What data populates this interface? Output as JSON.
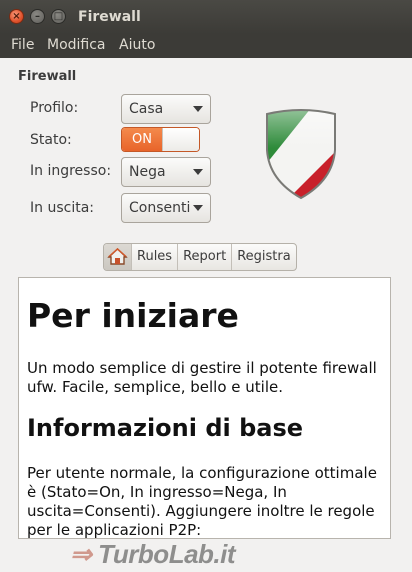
{
  "window": {
    "title": "Firewall"
  },
  "menubar": {
    "items": [
      "File",
      "Modifica",
      "Aiuto"
    ]
  },
  "section": {
    "title": "Firewall"
  },
  "form": {
    "profile": {
      "label": "Profilo:",
      "value": "Casa"
    },
    "status": {
      "label": "Stato:",
      "value": "ON"
    },
    "incoming": {
      "label": "In ingresso:",
      "value": "Nega"
    },
    "outgoing": {
      "label": "In uscita:",
      "value": "Consenti"
    }
  },
  "tabs": {
    "home_icon": "home-icon",
    "items": [
      "Rules",
      "Report",
      "Registra"
    ]
  },
  "content": {
    "h1": "Per iniziare",
    "p1": "Un modo semplice di gestire il potente firewall ufw. Facile, semplice, bello e utile.",
    "h2": "Informazioni di base",
    "p2": "Per utente normale, la configurazione ottimale è (Stato=On, In ingresso=Nega, In uscita=Consenti). Aggiungere inoltre le regole per le applicazioni P2P:"
  },
  "watermark": "TurboLab.it",
  "colors": {
    "accent": "#e8642a",
    "titlebar": "#3c3b37"
  }
}
